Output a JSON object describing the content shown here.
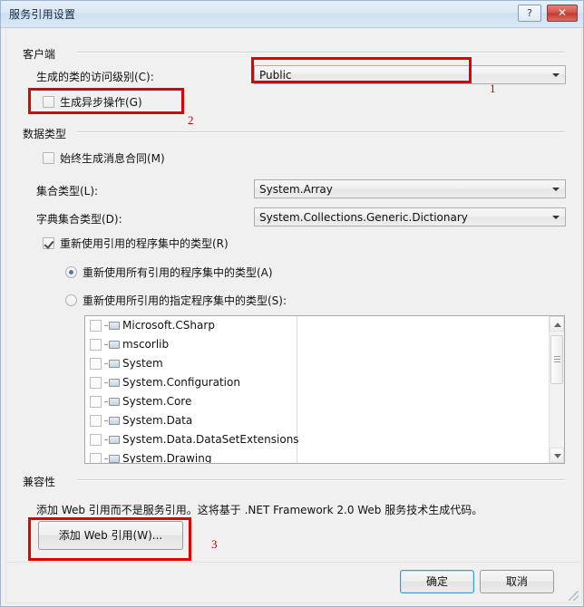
{
  "window": {
    "title": "服务引用设置",
    "help_button": "?",
    "close_button": "✕"
  },
  "groups": {
    "client": "客户端",
    "data_types": "数据类型",
    "compatibility": "兼容性"
  },
  "client_section": {
    "access_level_label": "生成的类的访问级别(C):",
    "access_level_value": "Public",
    "generate_async_label": "生成异步操作(G)",
    "generate_async_checked": false
  },
  "data_types_section": {
    "always_message_contracts_label": "始终生成消息合同(M)",
    "always_message_contracts_checked": false,
    "collection_type_label": "集合类型(L):",
    "collection_type_value": "System.Array",
    "dictionary_type_label": "字典集合类型(D):",
    "dictionary_type_value": "System.Collections.Generic.Dictionary",
    "reuse_types_label": "重新使用引用的程序集中的类型(R)",
    "reuse_types_checked": true,
    "reuse_all_label": "重新使用所有引用的程序集中的类型(A)",
    "reuse_all_selected": true,
    "reuse_specified_label": "重新使用所引用的指定程序集中的类型(S):",
    "reuse_specified_selected": false,
    "assemblies": [
      {
        "name": "Microsoft.CSharp",
        "checked": false
      },
      {
        "name": "mscorlib",
        "checked": false
      },
      {
        "name": "System",
        "checked": false
      },
      {
        "name": "System.Configuration",
        "checked": false
      },
      {
        "name": "System.Core",
        "checked": false
      },
      {
        "name": "System.Data",
        "checked": false
      },
      {
        "name": "System.Data.DataSetExtensions",
        "checked": false
      },
      {
        "name": "System.Drawing",
        "checked": false
      }
    ]
  },
  "compatibility_section": {
    "description": "添加 Web 引用而不是服务引用。这将基于 .NET Framework 2.0 Web 服务技术生成代码。",
    "add_web_reference_button": "添加 Web 引用(W)..."
  },
  "footer": {
    "ok_button": "确定",
    "cancel_button": "取消"
  },
  "annotations": {
    "marker_1": "1",
    "marker_2": "2",
    "marker_3": "3",
    "color": "#e00000"
  }
}
